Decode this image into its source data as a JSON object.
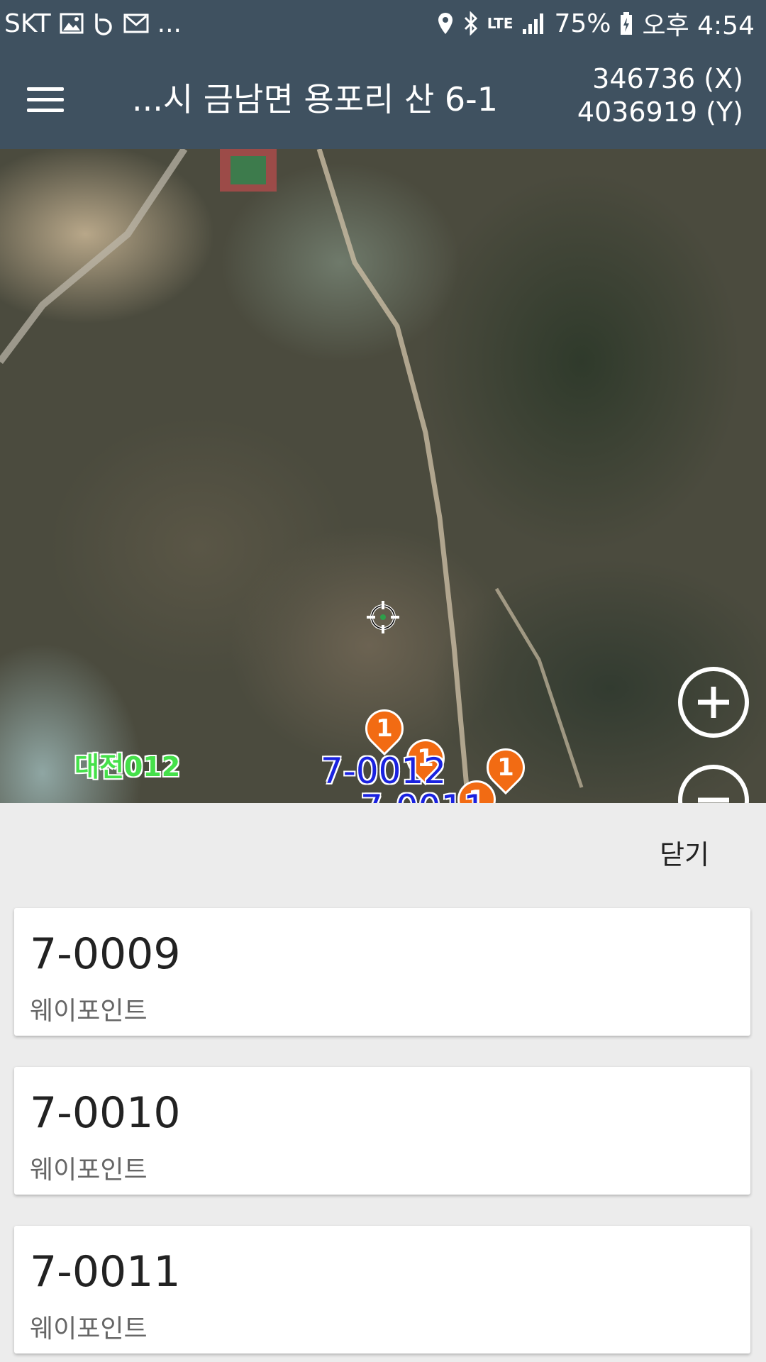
{
  "status_bar": {
    "carrier": "SKT",
    "overflow": "...",
    "network": "LTE",
    "battery": "75%",
    "time": "오후 4:54",
    "left_icons": [
      "image-icon",
      "b-app-icon",
      "mail-icon"
    ],
    "right_icons": [
      "location-icon",
      "bluetooth-icon",
      "signal-icon",
      "battery-icon"
    ]
  },
  "app_bar": {
    "title": "...시 금남면 용포리 산 6-1",
    "coord_x": "346736 (X)",
    "coord_y": "4036919 (Y)",
    "background": "#3f5160"
  },
  "map": {
    "labels": {
      "green": "대전012",
      "blue_main": "7-0012",
      "blue_partial": "7-0011"
    },
    "markers": [
      "1",
      "1",
      "1",
      "1"
    ],
    "marker_color": "#f26b13"
  },
  "sheet": {
    "close_label": "닫기",
    "items": [
      {
        "title": "7-0009",
        "subtitle": "웨이포인트"
      },
      {
        "title": "7-0010",
        "subtitle": "웨이포인트"
      },
      {
        "title": "7-0011",
        "subtitle": "웨이포인트"
      }
    ]
  }
}
